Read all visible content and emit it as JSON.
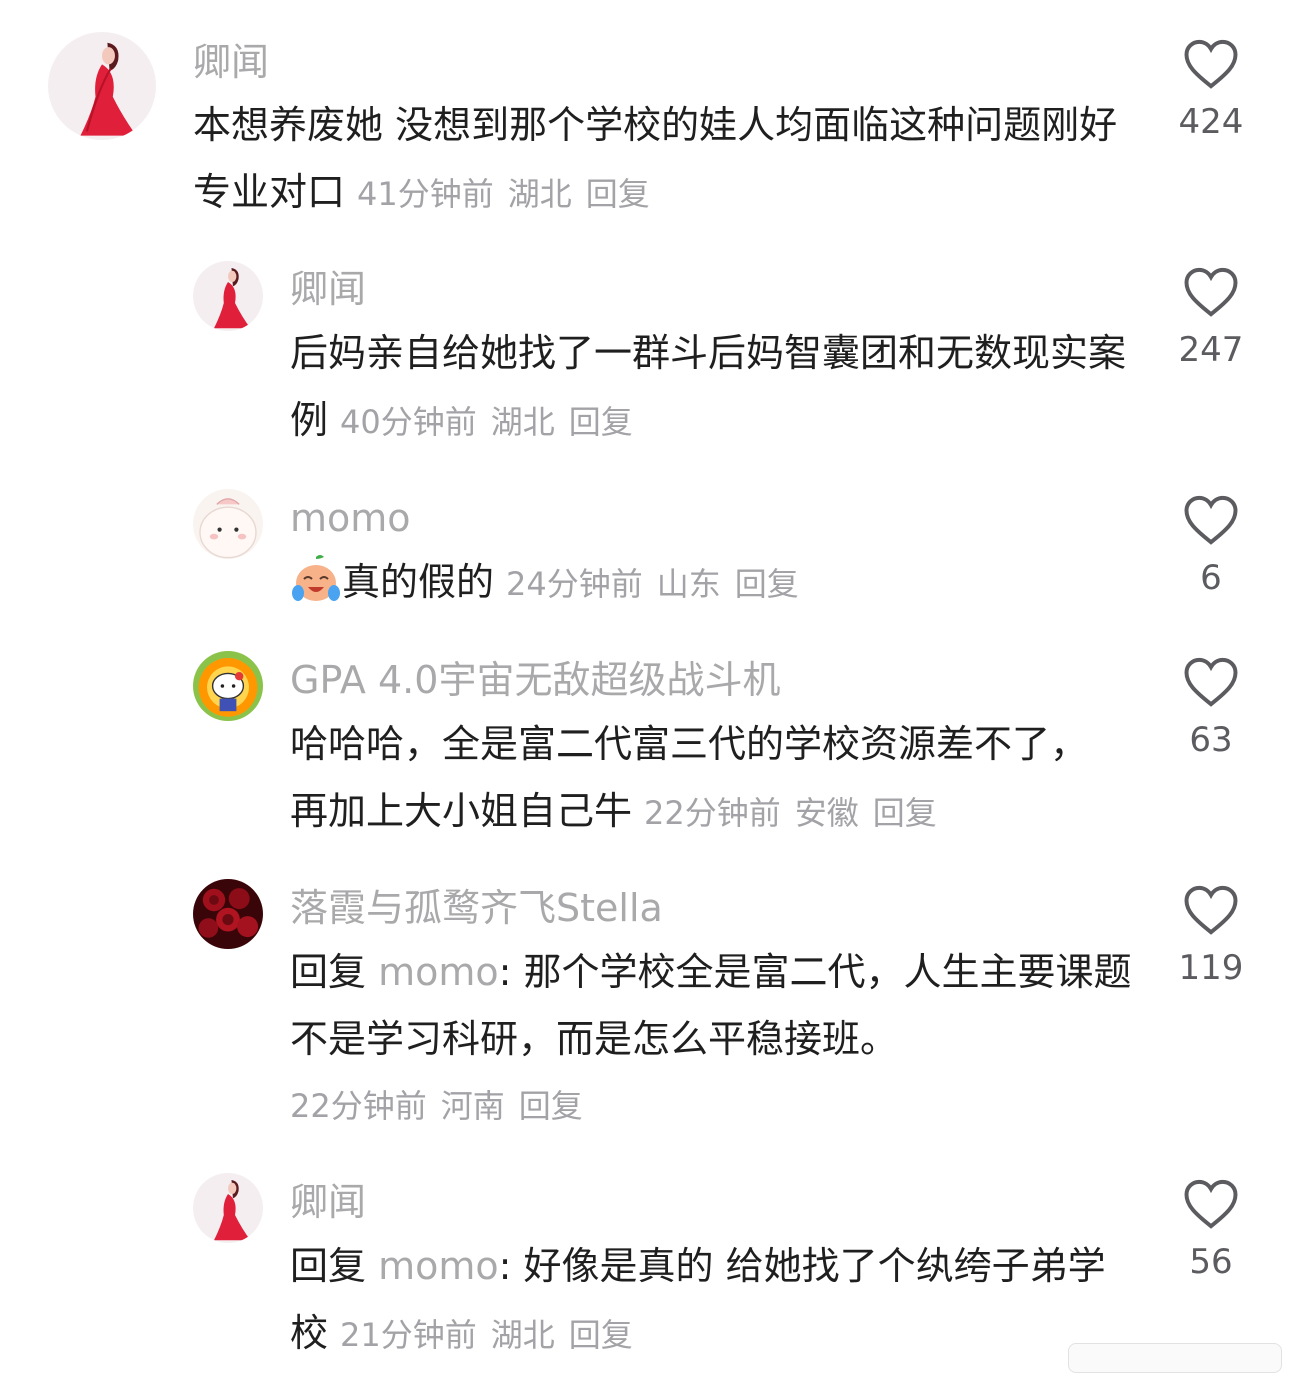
{
  "comments": [
    {
      "avatar": "red-dress-girl",
      "name": "卿闻",
      "text": "本想养废她 没想到那个学校的娃人均面临这种问题刚好专业对口",
      "time": "41分钟前",
      "region": "湖北",
      "reply_label": "回复",
      "likes": "424"
    },
    {
      "avatar": "red-dress-girl",
      "name": "卿闻",
      "text": "后妈亲自给她找了一群斗后妈智囊团和无数现实案例",
      "time": "40分钟前",
      "region": "湖北",
      "reply_label": "回复",
      "likes": "247"
    },
    {
      "avatar": "cartoon-peach",
      "name": "momo",
      "emoji": "crying-laughing-emoji",
      "text": "真的假的",
      "time": "24分钟前",
      "region": "山东",
      "reply_label": "回复",
      "likes": "6"
    },
    {
      "avatar": "hello-kitty-explosion",
      "name": "GPA 4.0宇宙无敌超级战斗机",
      "text": "哈哈哈，全是富二代富三代的学校资源差不了，再加上大小姐自己牛",
      "time": "22分钟前",
      "region": "安徽",
      "reply_label": "回复",
      "likes": "63"
    },
    {
      "avatar": "red-roses",
      "name": "落霞与孤鹜齐飞Stella",
      "reply_prefix": "回复",
      "reply_to": "momo",
      "text": ": 那个学校全是富二代，人生主要课题不是学习科研，而是怎么平稳接班。",
      "time": "22分钟前",
      "region": "河南",
      "reply_label": "回复",
      "likes": "119"
    },
    {
      "avatar": "red-dress-girl",
      "name": "卿闻",
      "reply_prefix": "回复",
      "reply_to": "momo",
      "text": ": 好像是真的 给她找了个纨绔子弟学校",
      "time": "21分钟前",
      "region": "湖北",
      "reply_label": "回复",
      "likes": "56"
    }
  ]
}
